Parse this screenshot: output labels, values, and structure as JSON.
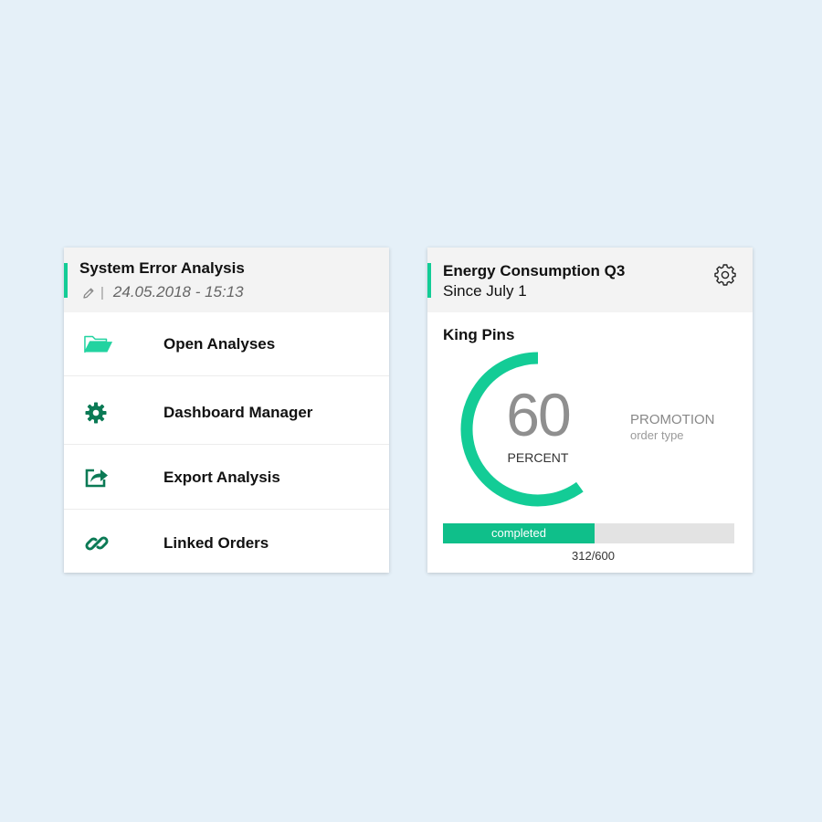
{
  "colors": {
    "accent": "#13cc96",
    "icon_dark": "#0b7a55",
    "icon_light": "#22d3a0",
    "progress_fill": "#0fbf8a",
    "background": "#e5f0f8"
  },
  "analysis_card": {
    "title": "System Error Analysis",
    "meta_icon": "pencil-icon",
    "meta_separator": "|",
    "timestamp": "24.05.2018 - 15:13",
    "menu": [
      {
        "label": "Open Analyses",
        "icon": "folder-open-icon"
      },
      {
        "label": "Dashboard Manager",
        "icon": "gear-icon"
      },
      {
        "label": "Export Analysis",
        "icon": "export-share-icon"
      },
      {
        "label": "Linked Orders",
        "icon": "link-icon"
      }
    ]
  },
  "kpi_card": {
    "title": "Energy Consumption Q3",
    "subtitle": "Since July 1",
    "settings_icon": "gear-icon",
    "section_title": "King Pins",
    "gauge": {
      "value": "60",
      "unit": "PERCENT",
      "fraction": 0.6
    },
    "promotion": {
      "title": "PROMOTION",
      "subtitle": "order type"
    },
    "progress": {
      "label": "completed",
      "current": 312,
      "total": 600,
      "count_text": "312/600"
    }
  }
}
